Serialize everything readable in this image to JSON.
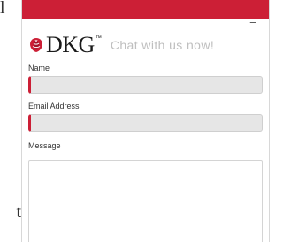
{
  "background_page": {
    "top_fragment": "l",
    "bottom_fragment": "t"
  },
  "widget": {
    "accent_color": "#cc1f36",
    "minimize_label": "–",
    "logo": {
      "text": "DKG",
      "trademark": "™",
      "icon": "rose-icon"
    },
    "title": "Chat with us now!"
  },
  "form": {
    "name_label": "Name",
    "name_value": "",
    "email_label": "Email Address",
    "email_value": "",
    "message_label": "Message",
    "message_value": ""
  }
}
